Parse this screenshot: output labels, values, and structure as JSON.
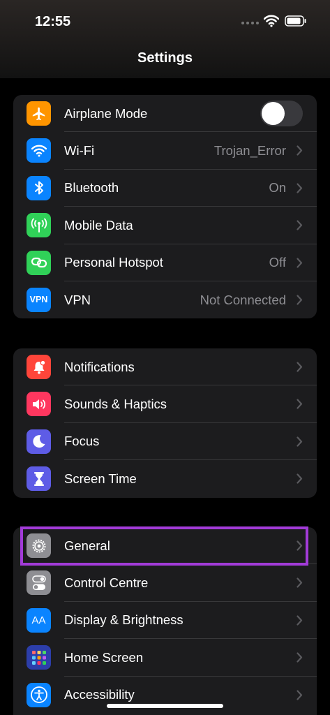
{
  "status_bar": {
    "time": "12:55"
  },
  "page_title": "Settings",
  "colors": {
    "highlight": "#a23bd8",
    "value_text": "#8e8e93"
  },
  "groups": [
    {
      "rows": [
        {
          "label": "Airplane Mode",
          "icon": "airplane-icon",
          "icon_bg": "#ff9500",
          "toggle": "off"
        },
        {
          "label": "Wi-Fi",
          "value": "Trojan_Error",
          "icon": "wifi-icon",
          "icon_bg": "#0a84ff"
        },
        {
          "label": "Bluetooth",
          "value": "On",
          "icon": "bluetooth-icon",
          "icon_bg": "#0a84ff"
        },
        {
          "label": "Mobile Data",
          "icon": "antenna-icon",
          "icon_bg": "#30d158"
        },
        {
          "label": "Personal Hotspot",
          "value": "Off",
          "icon": "hotspot-icon",
          "icon_bg": "#30d158"
        },
        {
          "label": "VPN",
          "value": "Not Connected",
          "icon": "vpn-icon",
          "icon_text": "VPN",
          "icon_bg": "#0a84ff"
        }
      ]
    },
    {
      "rows": [
        {
          "label": "Notifications",
          "icon": "bell-icon",
          "icon_bg": "#ff453a"
        },
        {
          "label": "Sounds & Haptics",
          "icon": "speaker-icon",
          "icon_bg": "#ff375f"
        },
        {
          "label": "Focus",
          "icon": "moon-icon",
          "icon_bg": "#5e5ce6"
        },
        {
          "label": "Screen Time",
          "icon": "hourglass-icon",
          "icon_bg": "#5e5ce6"
        }
      ]
    },
    {
      "rows": [
        {
          "label": "General",
          "icon": "gear-icon",
          "icon_bg": "#8e8e93"
        },
        {
          "label": "Control Centre",
          "icon": "toggles-icon",
          "icon_bg": "#8e8e93"
        },
        {
          "label": "Display & Brightness",
          "icon": "text-size-icon",
          "icon_text": "AA",
          "icon_bg": "#0a84ff"
        },
        {
          "label": "Home Screen",
          "icon": "app-grid-icon",
          "icon_bg": "#2c3eaa"
        },
        {
          "label": "Accessibility",
          "icon": "accessibility-icon",
          "icon_bg": "#0a84ff"
        }
      ]
    }
  ]
}
